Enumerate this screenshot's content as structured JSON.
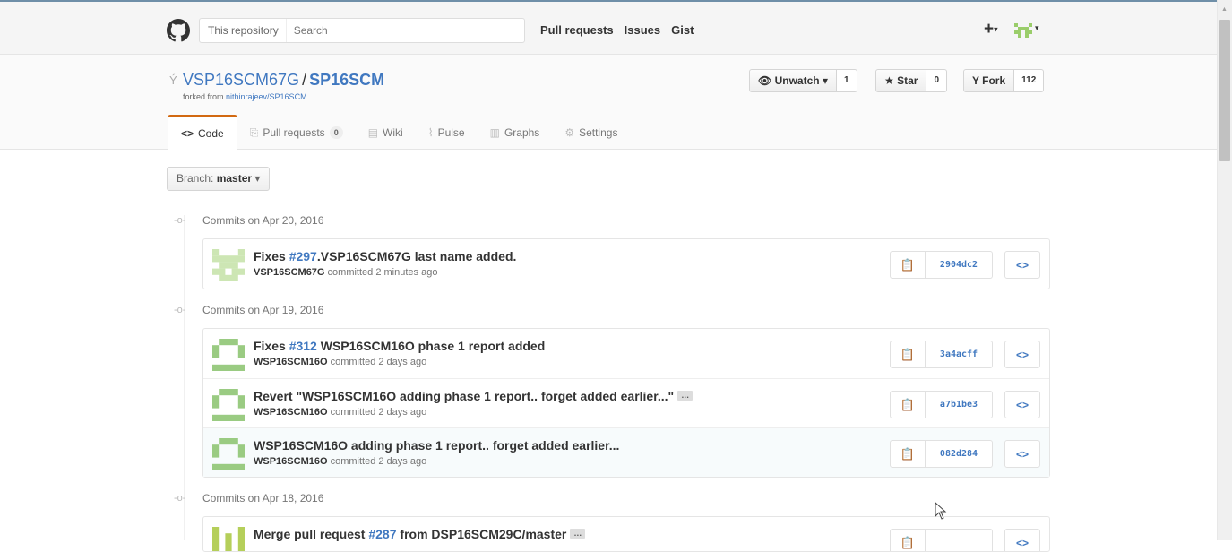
{
  "header": {
    "search_scope": "This repository",
    "search_placeholder": "Search",
    "nav": [
      "Pull requests",
      "Issues",
      "Gist"
    ],
    "new_label": "+"
  },
  "repo": {
    "owner": "VSP16SCM67G",
    "separator": "/",
    "name": "SP16SCM",
    "forked_prefix": "forked from ",
    "forked_source": "nithinrajeev/SP16SCM",
    "actions": [
      {
        "label": "Unwatch",
        "count": "1"
      },
      {
        "label": "Star",
        "count": "0"
      },
      {
        "label": "Fork",
        "count": "112"
      }
    ],
    "tabs": [
      {
        "label": "Code",
        "icon": "code-icon"
      },
      {
        "label": "Pull requests",
        "icon": "pull-request-icon",
        "counter": "0"
      },
      {
        "label": "Wiki",
        "icon": "book-icon"
      },
      {
        "label": "Pulse",
        "icon": "pulse-icon"
      },
      {
        "label": "Graphs",
        "icon": "graph-icon"
      },
      {
        "label": "Settings",
        "icon": "gear-icon"
      }
    ]
  },
  "branch": {
    "prefix": "Branch:",
    "name": "master"
  },
  "commit_groups": [
    {
      "date": "Commits on Apr 20, 2016",
      "commits": [
        {
          "title_before": "Fixes ",
          "issue": "#297",
          "title_after": ".VSP16SCM67G last name added.",
          "author": "VSP16SCM67G",
          "time": " committed 2 minutes ago",
          "sha": "2904dc2",
          "ellipsis": false,
          "avatar_color": "#9acd6a"
        }
      ]
    },
    {
      "date": "Commits on Apr 19, 2016",
      "commits": [
        {
          "title_before": "Fixes ",
          "issue": "#312",
          "title_after": " WSP16SCM16O phase 1 report added",
          "author": "WSP16SCM16O",
          "time": " committed 2 days ago",
          "sha": "3a4acff",
          "ellipsis": false,
          "avatar_color": "#8fbc7a"
        },
        {
          "title_before": "Revert \"WSP16SCM16O adding phase 1 report.. forget added earlier...\"",
          "issue": "",
          "title_after": "",
          "author": "WSP16SCM16O",
          "time": " committed 2 days ago",
          "sha": "a7b1be3",
          "ellipsis": true,
          "avatar_color": "#8fbc7a"
        },
        {
          "title_before": "WSP16SCM16O adding phase 1 report.. forget added earlier...",
          "issue": "",
          "title_after": "",
          "author": "WSP16SCM16O",
          "time": " committed 2 days ago",
          "sha": "082d284",
          "ellipsis": false,
          "avatar_color": "#8fbc7a"
        }
      ]
    },
    {
      "date": "Commits on Apr 18, 2016",
      "commits": [
        {
          "title_before": "Merge pull request ",
          "issue": "#287",
          "title_after": " from DSP16SCM29C/master",
          "author": "",
          "time": "",
          "sha": "",
          "ellipsis": true,
          "avatar_color": "#b5cf5a"
        }
      ]
    }
  ],
  "ellipsis_label": "…",
  "colors": {
    "link": "#4078c0",
    "tab_accent": "#d26911"
  }
}
